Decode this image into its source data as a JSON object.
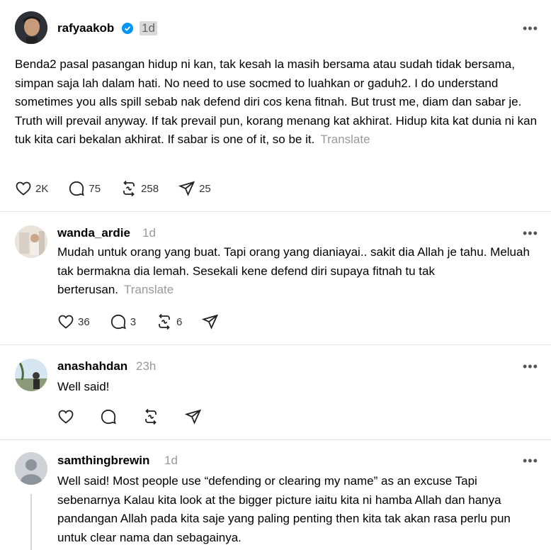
{
  "posts": [
    {
      "username": "rafyaakob",
      "time": "1d",
      "text": "Benda2 pasal pasangan hidup ni kan, tak kesah la masih bersama atau sudah tidak bersama, simpan saja lah dalam hati. No need to use socmed to luahkan or gaduh2. I do understand sometimes you alls spill sebab nak defend diri cos kena fitnah. But trust me, diam dan sabar je. Truth will prevail anyway. If tak prevail pun, korang menang kat akhirat. Hidup kita kat dunia ni kan tuk kita cari bekalan akhirat. If sabar is one of it, so be it.",
      "translate": "Translate",
      "likes": "2K",
      "replies": "75",
      "reposts": "258",
      "shares": "25",
      "more": "•••"
    },
    {
      "username": "wanda_ardie",
      "time": "1d",
      "text": "Mudah untuk orang yang buat. Tapi orang yang dianiayai.. sakit dia Allah je tahu. Meluah tak bermakna dia lemah. Sesekali kene defend diri supaya fitnah tu tak berterusan.",
      "translate": "Translate",
      "likes": "36",
      "replies": "3",
      "reposts": "6",
      "more": "•••"
    },
    {
      "username": "anashahdan",
      "time": "23h",
      "text": "Well said!",
      "more": "•••"
    },
    {
      "username": "samthingbrewin",
      "time": "1d",
      "text": "Well said! Most people use “defending or clearing my name” as an excuse Tapi sebenarnya Kalau kita look at the bigger picture iaitu kita ni hamba Allah dan hanya pandangan Allah pada kita saje yang paling penting then kita tak akan rasa perlu pun untuk clear nama dan sebagainya.",
      "more": "•••"
    }
  ],
  "icons": {
    "like": "heart-icon",
    "reply": "comment-icon",
    "repost": "repost-icon",
    "share": "send-icon",
    "verified": "verified-badge-icon"
  },
  "colors": {
    "verified": "#0095f6",
    "muted": "#999999",
    "divider": "#e5e5e5"
  }
}
